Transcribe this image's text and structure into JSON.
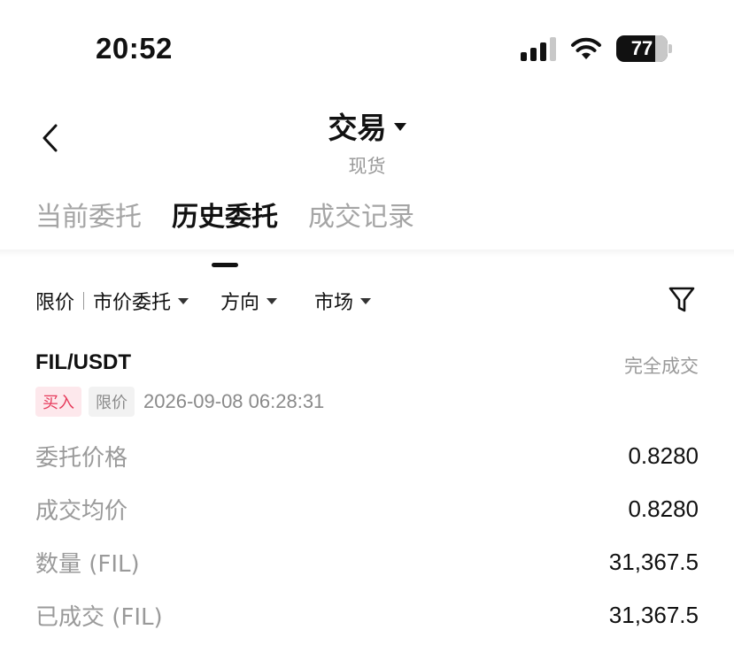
{
  "status_bar": {
    "time": "20:52",
    "battery_level": "77"
  },
  "header": {
    "title": "交易",
    "subtitle": "现货"
  },
  "tabs": [
    {
      "label": "当前委托",
      "active": false
    },
    {
      "label": "历史委托",
      "active": true
    },
    {
      "label": "成交记录",
      "active": false
    }
  ],
  "filters": {
    "limit": "限价",
    "market_order": "市价委托",
    "direction": "方向",
    "market": "市场"
  },
  "order": {
    "pair": "FIL/USDT",
    "status": "完全成交",
    "side": "买入",
    "type": "限价",
    "time": "2026-09-08 06:28:31",
    "details": [
      {
        "label": "委托价格",
        "value": "0.8280"
      },
      {
        "label": "成交均价",
        "value": "0.8280"
      },
      {
        "label": "数量 (FIL)",
        "value": "31,367.5"
      },
      {
        "label": "已成交 (FIL)",
        "value": "31,367.5"
      }
    ]
  },
  "colors": {
    "buy": "#e6395a",
    "buy_bg": "#fde8ec",
    "muted": "#9a9a9a",
    "text": "#111111"
  }
}
